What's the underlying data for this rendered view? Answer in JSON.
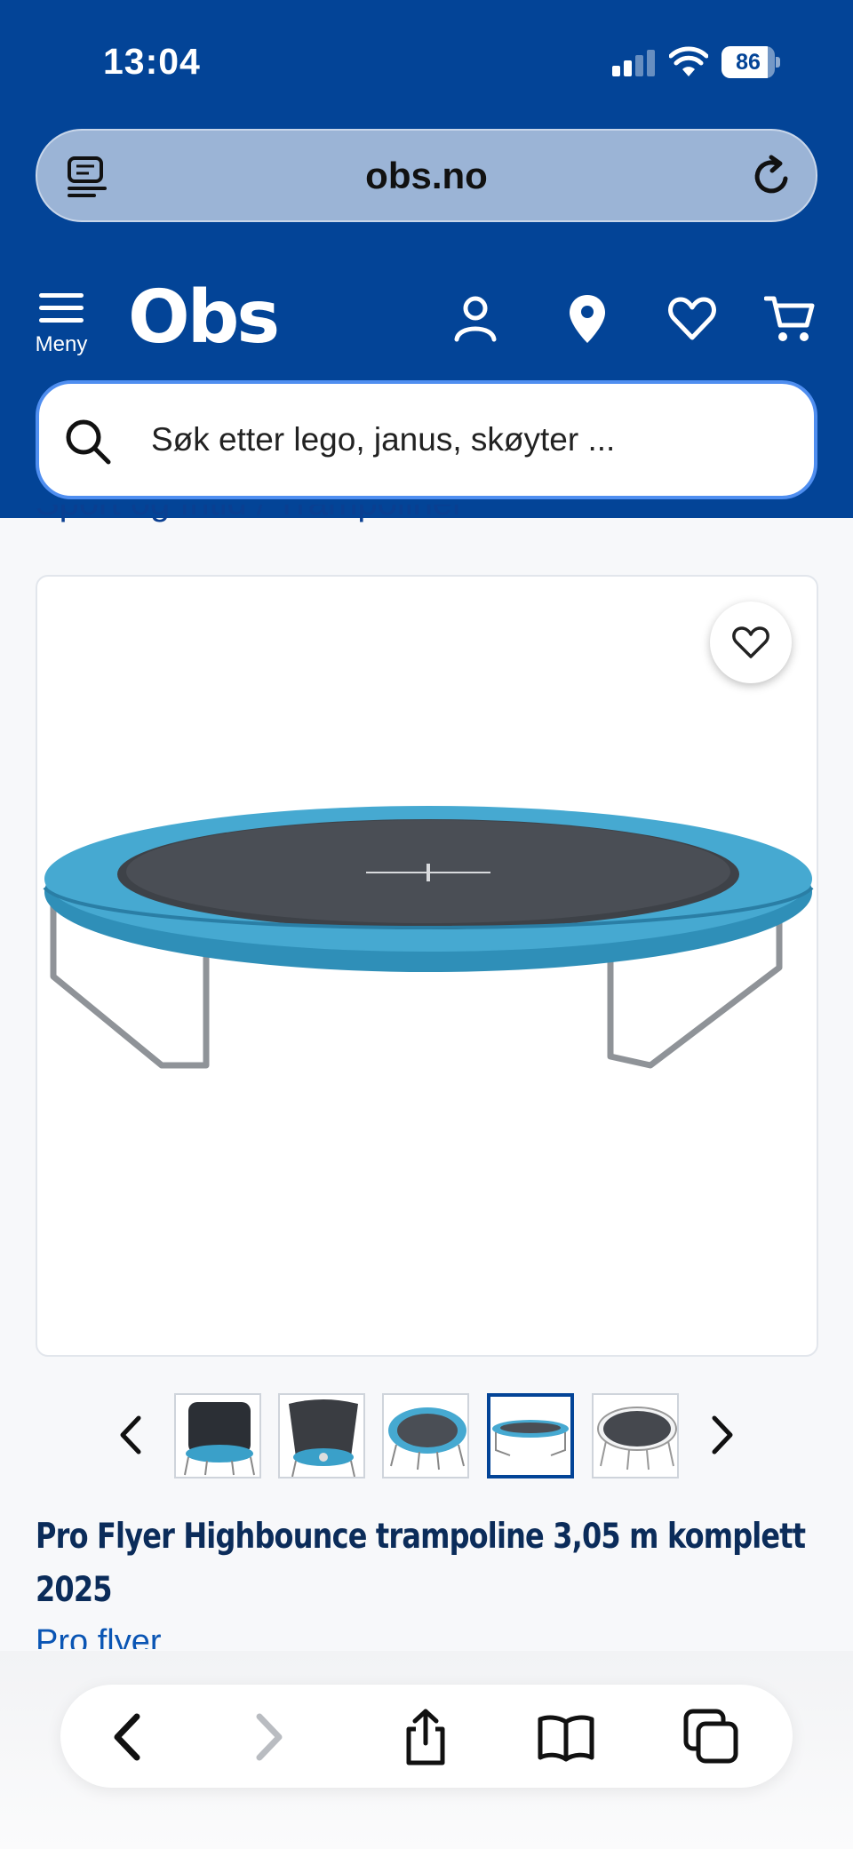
{
  "status_bar": {
    "time": "13:04",
    "battery": "86",
    "battery_level": 0.86
  },
  "browser": {
    "url": "obs.no"
  },
  "header": {
    "menu_label": "Meny",
    "logo": "Obs",
    "icons": [
      "account-icon",
      "location-pin-icon",
      "heart-icon",
      "cart-icon"
    ]
  },
  "search": {
    "placeholder": "Søk etter lego, janus, skøyter ..."
  },
  "breadcrumb_peek": "Sport og fritid / Trampoliner",
  "product": {
    "title": "Pro Flyer Highbounce trampoline 3,05 m komplett 2025",
    "brand": "Pro flyer",
    "thumbnails_count": 5,
    "active_thumbnail": 4
  },
  "colors": {
    "header_blue": "#034497",
    "trampoline_pad": "#3aa0c9",
    "search_border": "#4f8ef0"
  },
  "bottom_bar": {
    "icons": [
      "back-icon",
      "forward-icon",
      "share-icon",
      "bookmarks-icon",
      "tabs-icon"
    ]
  }
}
